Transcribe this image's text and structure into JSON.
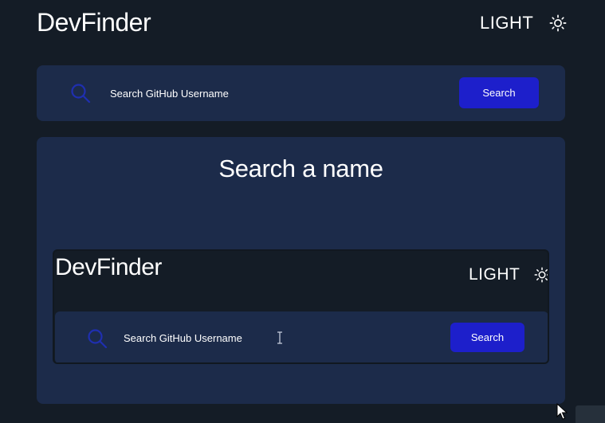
{
  "header": {
    "title": "DevFinder",
    "theme_label": "LIGHT",
    "theme_icon": "sun-icon"
  },
  "search": {
    "placeholder": "Search GitHub Username",
    "button_label": "Search",
    "icon": "search-icon"
  },
  "result": {
    "heading": "Search a name"
  },
  "preview": {
    "title": "DevFinder",
    "theme_label": "LIGHT",
    "search_placeholder": "Search GitHub Username",
    "search_button_label": "Search"
  },
  "colors": {
    "background": "#141c26",
    "card": "#1c2b4a",
    "accent": "#1d1fcb",
    "search_icon": "#1f2fb0",
    "text": "#ffffff"
  }
}
